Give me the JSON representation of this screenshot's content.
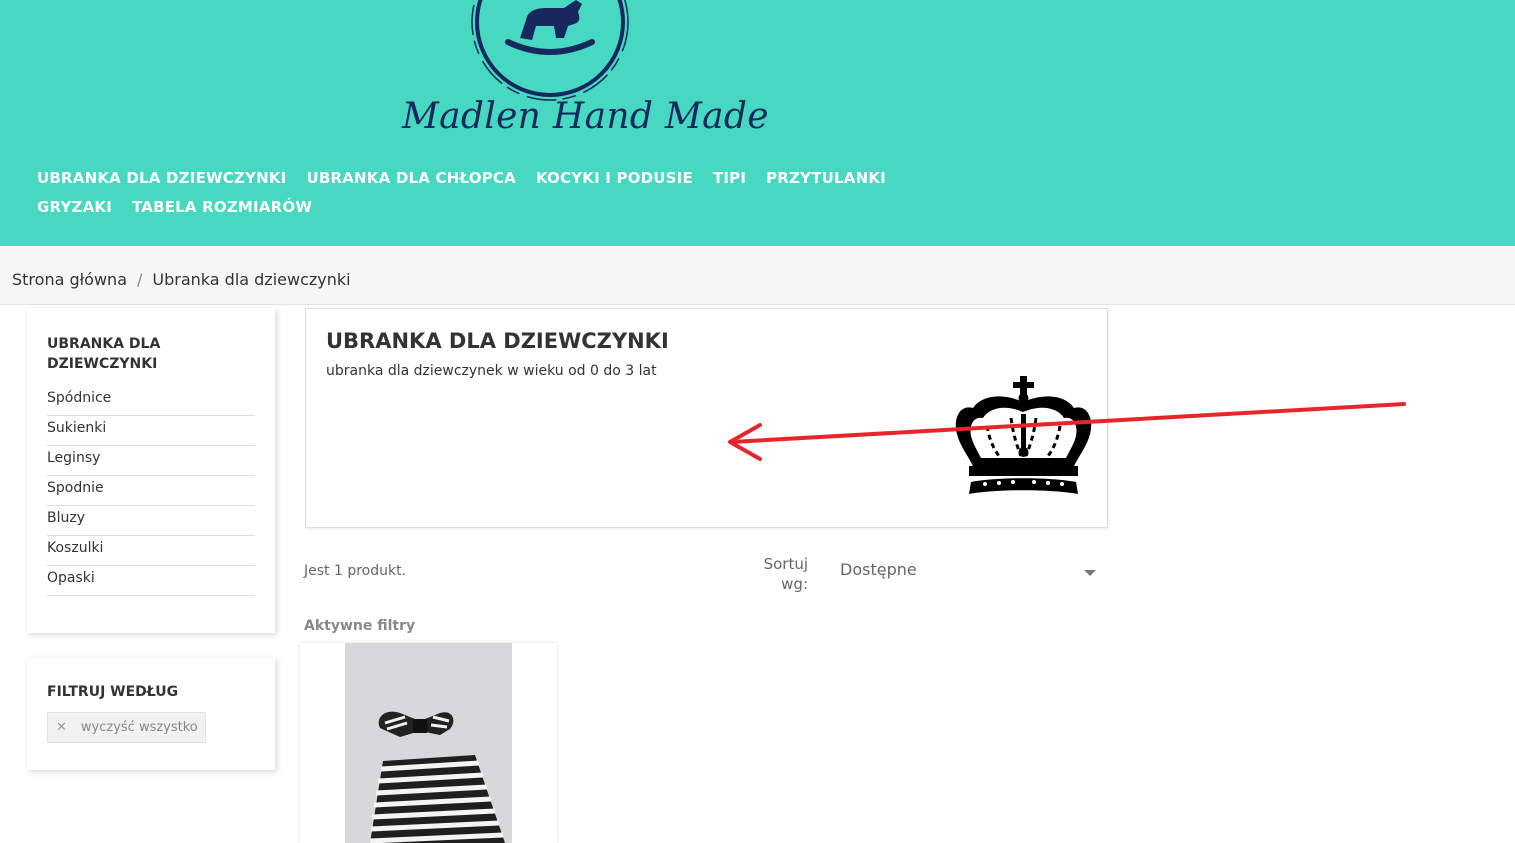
{
  "brand": {
    "name": "Madlen Hand Made",
    "primary_color": "#46d8c0",
    "logo_color": "#17285e",
    "logo_icon": "rocking-horse-icon"
  },
  "nav": {
    "items": [
      {
        "label": "UBRANKA DLA DZIEWCZYNKI"
      },
      {
        "label": "UBRANKA DLA CHŁOPCA"
      },
      {
        "label": "KOCYKI I PODUSIE"
      },
      {
        "label": "TIPI"
      },
      {
        "label": "PRZYTULANKI"
      },
      {
        "label": "GRYZAKI"
      },
      {
        "label": "TABELA ROZMIARÓW"
      }
    ]
  },
  "breadcrumb": {
    "items": [
      {
        "label": "Strona główna"
      },
      {
        "label": "Ubranka dla dziewczynki"
      }
    ],
    "separator": "/"
  },
  "sidebar": {
    "category_title": "UBRANKA DLA DZIEWCZYNKI",
    "subcategories": [
      {
        "label": "Spódnice"
      },
      {
        "label": "Sukienki"
      },
      {
        "label": "Leginsy"
      },
      {
        "label": "Spodnie"
      },
      {
        "label": "Bluzy"
      },
      {
        "label": "Koszulki"
      },
      {
        "label": "Opaski"
      }
    ],
    "filter_title": "FILTRUJ WEDŁUG",
    "clear_all": {
      "icon": "close-icon",
      "label": "wyczyść wszystko"
    }
  },
  "category": {
    "title": "UBRANKA DLA DZIEWCZYNKI",
    "description": "ubranka dla dziewczynek w wieku od 0 do 3 lat",
    "image_icon": "crown-icon",
    "annotation": {
      "icon": "arrow-left-icon",
      "color": "#e8262a"
    }
  },
  "listing": {
    "product_count": "Jest 1 produkt.",
    "sort_label": "Sortuj wg:",
    "sort_value": "Dostępne",
    "active_filters": "Aktywne filtry"
  }
}
